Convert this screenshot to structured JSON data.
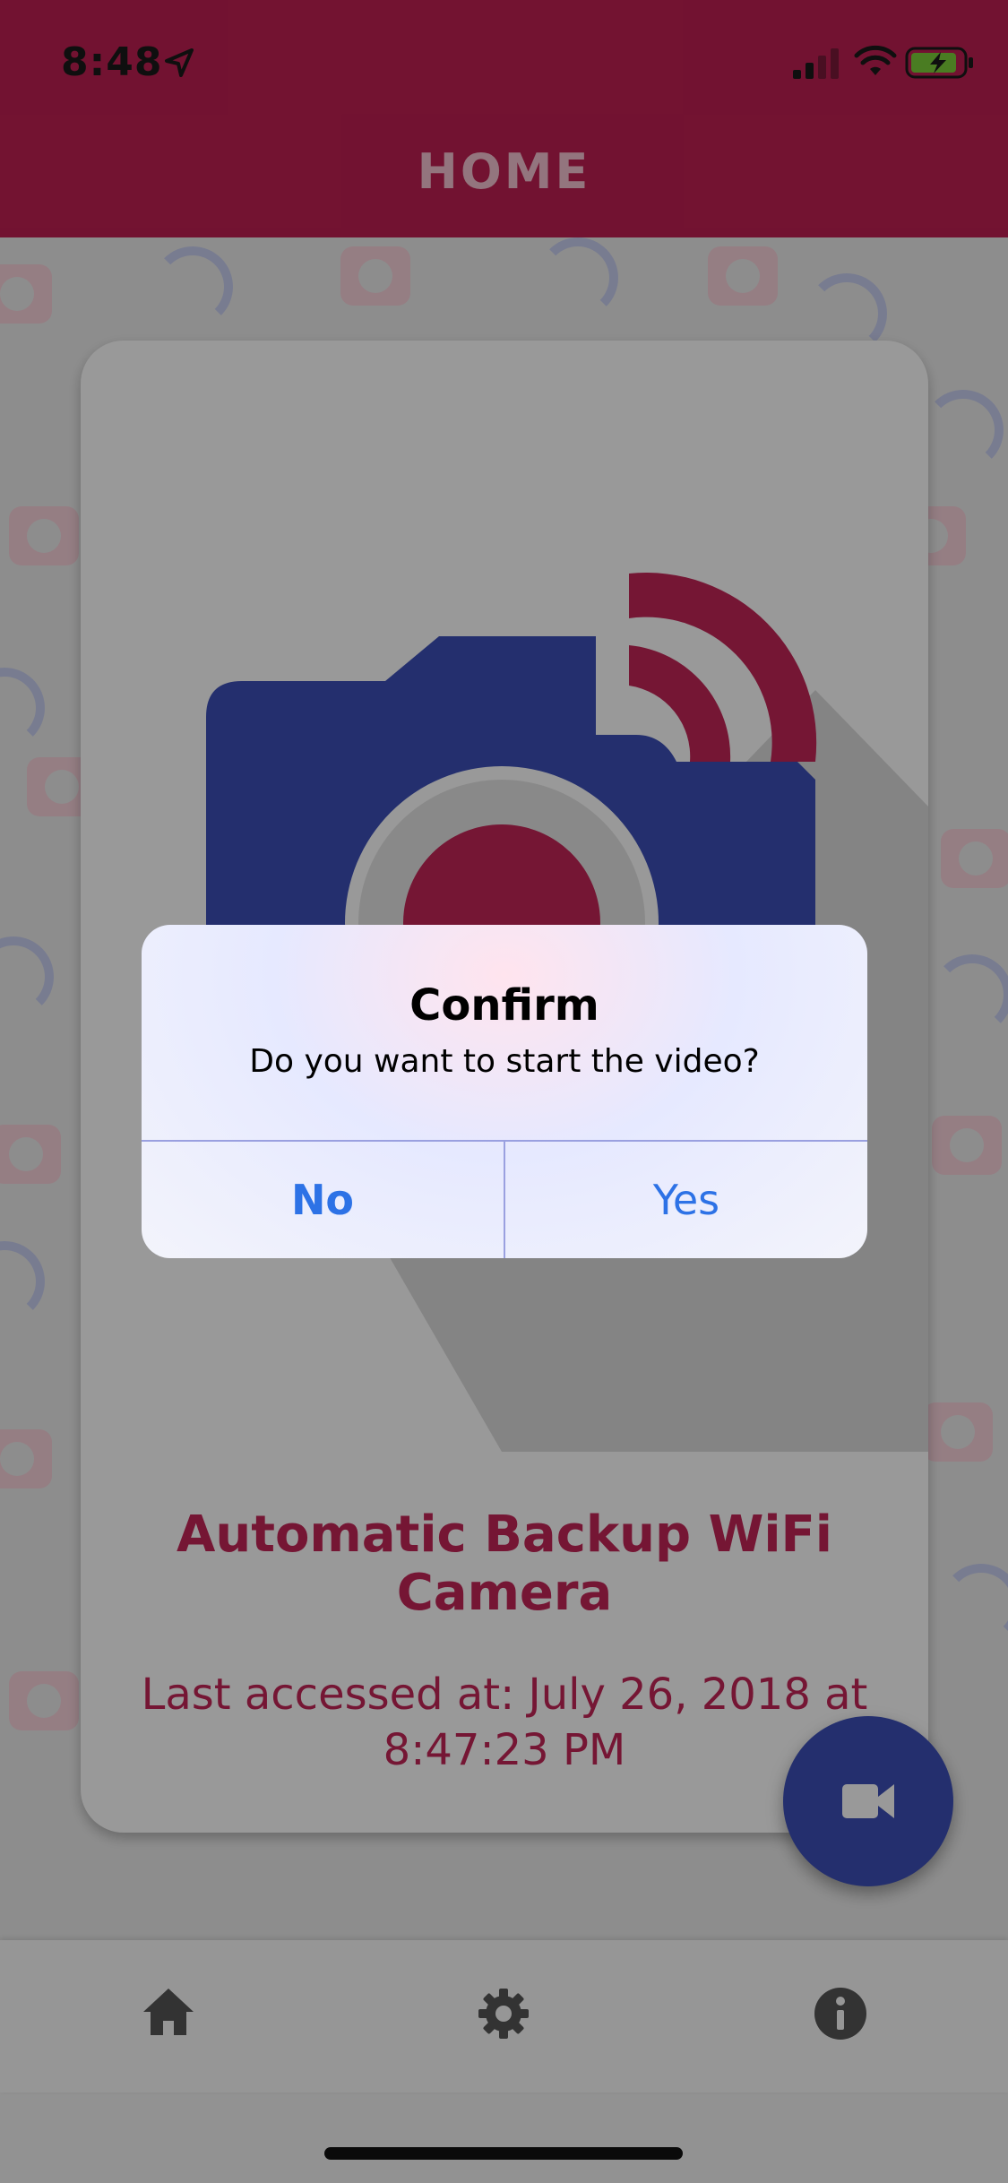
{
  "status_bar": {
    "time": "8:48"
  },
  "header": {
    "title": "HOME"
  },
  "card": {
    "title": "Automatic Backup WiFi Camera",
    "last_accessed": "Last accessed at: July 26, 2018 at 8:47:23 PM"
  },
  "fab": {
    "icon": "video-camera-icon"
  },
  "bottom_nav": {
    "items": [
      {
        "icon": "home-icon"
      },
      {
        "icon": "gear-icon"
      },
      {
        "icon": "info-icon"
      }
    ]
  },
  "dialog": {
    "title": "Confirm",
    "message": "Do you want to start the video?",
    "no_label": "No",
    "yes_label": "Yes"
  },
  "colors": {
    "primary": "#bf1f52",
    "secondary": "#3c4fb8",
    "link": "#2d72e6"
  }
}
